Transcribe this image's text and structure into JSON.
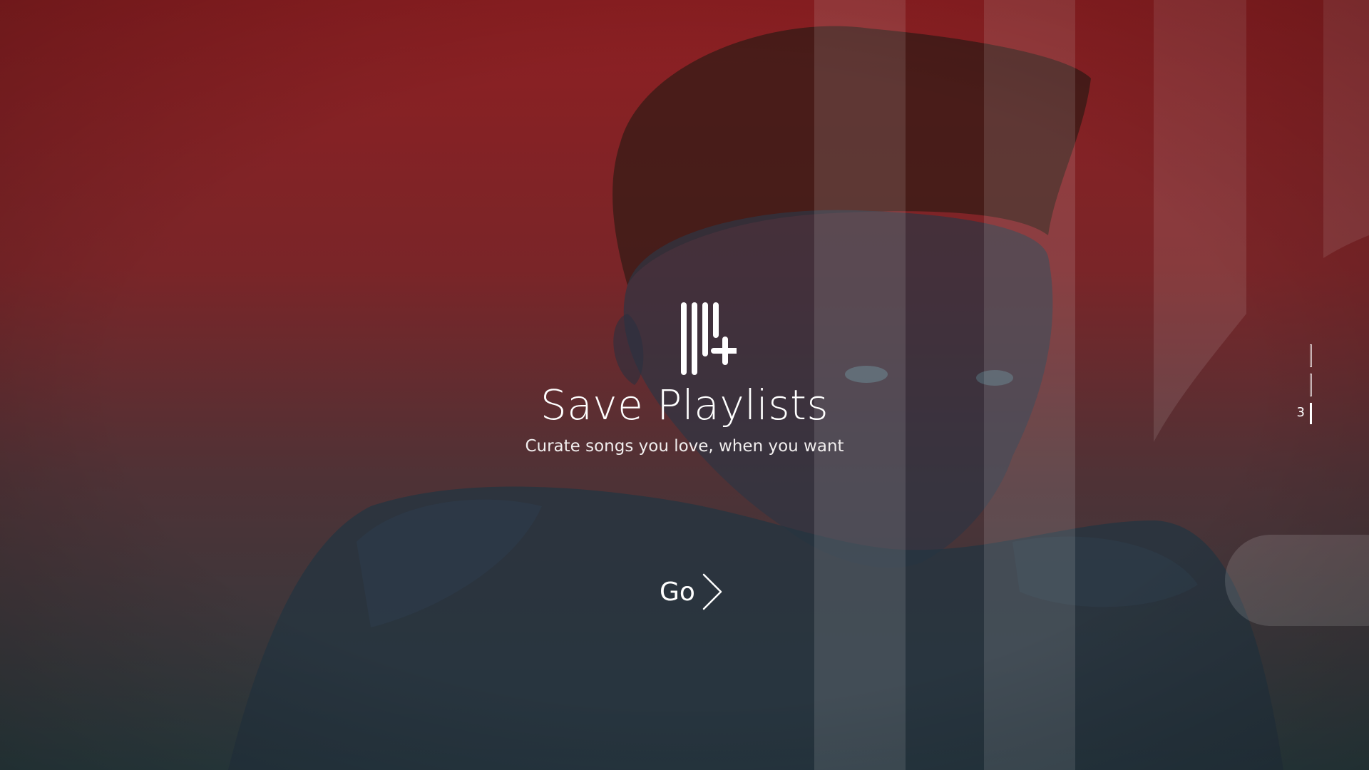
{
  "slide": {
    "title": "Save Playlists",
    "subtitle": "Curate songs you love, when you want",
    "icon": "playlist-add-icon"
  },
  "actions": {
    "go_label": "Go",
    "go_icon": "chevron-right-icon"
  },
  "pager": {
    "current_label": "3",
    "total": 3,
    "current": 3
  },
  "colors": {
    "background_top": "#8e1f22",
    "background_bottom": "#2a3a3f",
    "stripe_overlay": "#ffffff",
    "text": "#ffffff"
  }
}
